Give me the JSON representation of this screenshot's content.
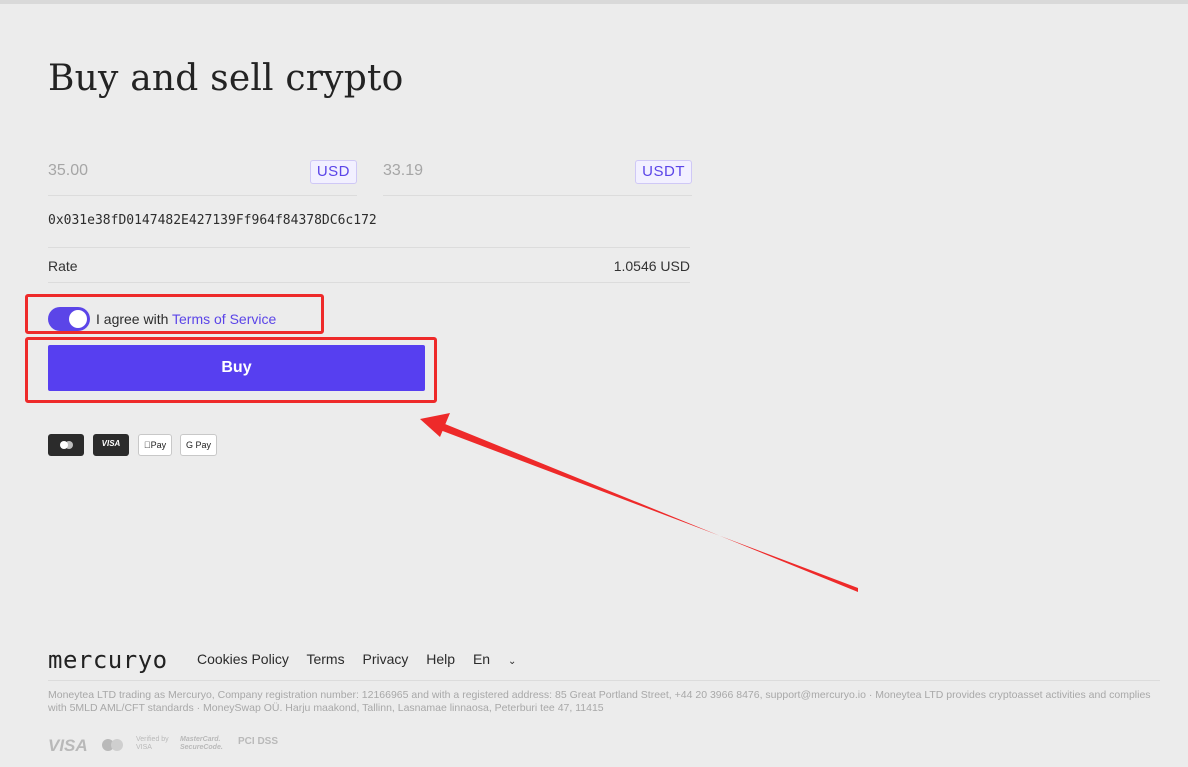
{
  "page": {
    "title": "Buy and sell crypto"
  },
  "exchange": {
    "pay_amount": "35.00",
    "pay_currency": "USD",
    "get_amount": "33.19",
    "get_currency": "USDT",
    "wallet_address": "0x031e38fD0147482E427139Ff964f84378DC6c172",
    "rate_label": "Rate",
    "rate_value": "1.0546 USD"
  },
  "agreement": {
    "text": "I agree with",
    "link": "Terms of Service",
    "checked": true
  },
  "buy_button": {
    "label": "Buy"
  },
  "payment_methods": [
    {
      "name": "mastercard-icon",
      "label": ""
    },
    {
      "name": "visa-icon",
      "label": "VISA"
    },
    {
      "name": "apple-pay-icon",
      "label": "Pay"
    },
    {
      "name": "google-pay-icon",
      "label": "G Pay"
    }
  ],
  "footer": {
    "brand": "mercuryo",
    "links": [
      "Cookies Policy",
      "Terms",
      "Privacy",
      "Help",
      "En"
    ],
    "legal": "Moneytea LTD trading as Mercuryo, Company registration number: 12166965 and with a registered address: 85 Great Portland Street, +44 20 3966 8476, support@mercuryo.io · Moneytea LTD provides cryptoasset activities and complies with 5MLD AML/CFT standards · MoneySwap OÜ. Harju maakond, Tallinn, Lasnamae linnaosa, Peterburi tee 47, 11415",
    "security_badges": [
      "VISA",
      "Verified by VISA",
      "MasterCard. SecureCode.",
      "PCI DSS"
    ]
  },
  "annotation": {
    "highlight_color": "#ee2a2a",
    "accent": "#573ff0"
  }
}
